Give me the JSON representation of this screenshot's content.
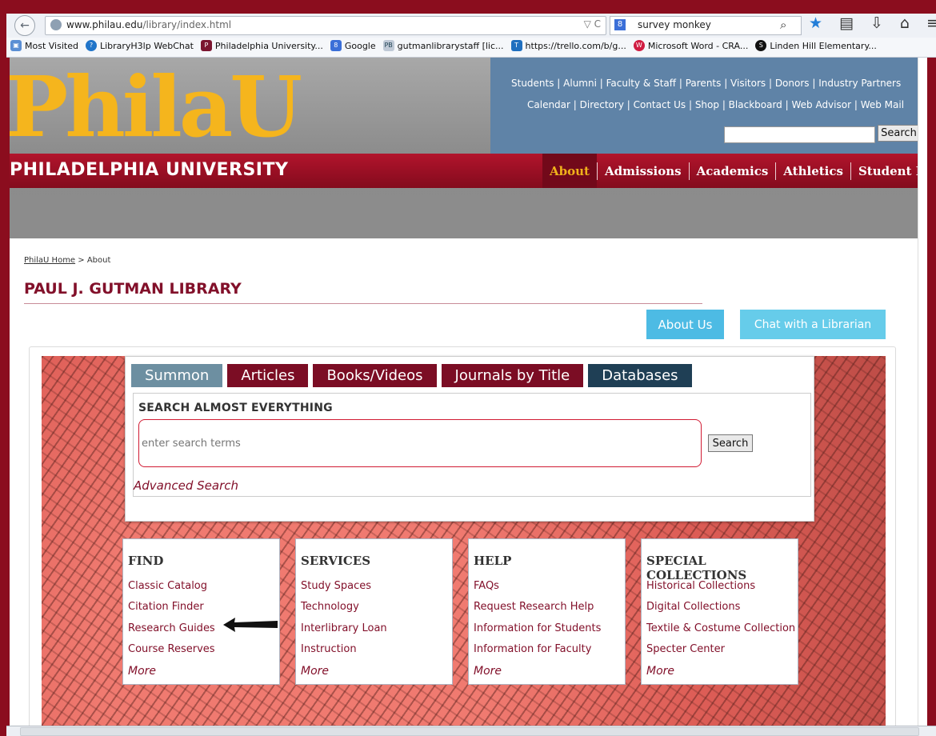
{
  "browser": {
    "url_domain": "www.philau.edu",
    "url_path": "/library/index.html",
    "url_controls": "▽ C",
    "search_value": "survey monkey",
    "search_engine_icon": "8",
    "bookmarks": [
      {
        "label": "Most Visited",
        "icon": "most-visited-icon",
        "glyph": "▣"
      },
      {
        "label": "LibraryH3lp WebChat",
        "icon": "help-icon",
        "glyph": "?"
      },
      {
        "label": "Philadelphia University...",
        "icon": "philau-icon",
        "glyph": "P"
      },
      {
        "label": "Google",
        "icon": "google-icon",
        "glyph": "8"
      },
      {
        "label": "gutmanlibrarystaff [lic...",
        "icon": "pbworks-icon",
        "glyph": "PB"
      },
      {
        "label": "https://trello.com/b/g...",
        "icon": "trello-icon",
        "glyph": "T"
      },
      {
        "label": "Microsoft Word - CRA...",
        "icon": "word-icon",
        "glyph": "W"
      },
      {
        "label": "Linden Hill Elementary...",
        "icon": "linden-icon",
        "glyph": "S"
      }
    ]
  },
  "header": {
    "logo_part1": "Phila",
    "logo_part2": "U",
    "university_name": "PHILADELPHIA UNIVERSITY",
    "top_links_line1": "Students | Alumni | Faculty & Staff | Parents | Visitors | Donors | Industry Partners",
    "top_links_line2": "Calendar | Directory | Contact Us | Shop | Blackboard | Web Advisor | Web Mail",
    "search_button": "Search",
    "nav": [
      "About",
      "Admissions",
      "Academics",
      "Athletics",
      "Student Life"
    ]
  },
  "breadcrumb": {
    "home": "PhilaU Home",
    "separator": " > ",
    "current": "About"
  },
  "page_title": "PAUL J. GUTMAN LIBRARY",
  "buttons": {
    "about_us": "About Us",
    "chat": "Chat with a Librarian"
  },
  "search": {
    "tabs": [
      "Summon",
      "Articles",
      "Books/Videos",
      "Journals by Title",
      "Databases"
    ],
    "heading": "SEARCH ALMOST EVERYTHING",
    "placeholder": "enter search terms",
    "button": "Search",
    "advanced": "Advanced Search"
  },
  "columns": [
    {
      "title": "FIND",
      "links": [
        "Classic Catalog",
        "Citation Finder",
        "Research Guides",
        "Course Reserves"
      ],
      "more": "More"
    },
    {
      "title": "SERVICES",
      "links": [
        "Study Spaces",
        "Technology",
        "Interlibrary Loan",
        "Instruction"
      ],
      "more": "More"
    },
    {
      "title": "HELP",
      "links": [
        "FAQs",
        "Request Research Help",
        "Information for Students",
        "Information for Faculty"
      ],
      "more": "More"
    },
    {
      "title": "SPECIAL COLLECTIONS",
      "links": [
        "Historical Collections",
        "Digital Collections",
        "Textile & Costume Collection",
        "Specter Center"
      ],
      "more": "More"
    }
  ],
  "colors": {
    "brand_red": "#82102a",
    "gold": "#f5b51d",
    "blue_header": "#5f83a7",
    "cyan_button": "#4dbbe4"
  }
}
